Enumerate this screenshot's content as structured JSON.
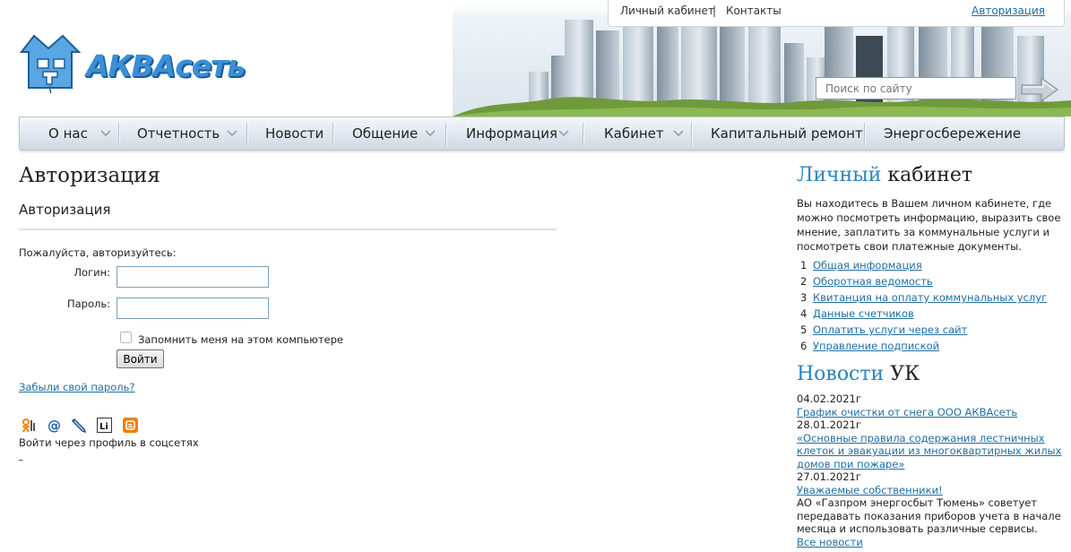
{
  "header": {
    "top_links": [
      "Личный кабинет",
      "Контакты"
    ],
    "top_separator": "|",
    "auth_link": "Авторизация",
    "logo_text": "АКВАсеть",
    "search_placeholder": "Поиск по сайту"
  },
  "nav": {
    "items": [
      {
        "label": "О нас",
        "has_dropdown": true
      },
      {
        "label": "Отчетность",
        "has_dropdown": true
      },
      {
        "label": "Новости",
        "has_dropdown": false
      },
      {
        "label": "Общение",
        "has_dropdown": true
      },
      {
        "label": "Информация",
        "has_dropdown": true
      },
      {
        "label": "Кабинет",
        "has_dropdown": true
      },
      {
        "label": "Капитальный ремонт",
        "has_dropdown": false
      },
      {
        "label": "Энергосбережение",
        "has_dropdown": false
      }
    ]
  },
  "main": {
    "title": "Авторизация",
    "subtitle": "Авторизация",
    "prompt": "Пожалуйста, авторизуйтесь:",
    "login_label": "Логин:",
    "login_value": "",
    "password_label": "Пароль:",
    "password_value": "",
    "remember_label": "Запомнить меня на этом компьютере",
    "remember_checked": false,
    "submit_label": "Войти",
    "forgot_link": "Забыли свой пароль?",
    "social_icons": [
      "odnoklassniki-icon",
      "mail-ru-icon",
      "livejournal-icon",
      "liveinternet-icon",
      "blogger-icon"
    ],
    "social_text": "Войти через профиль в соцсетях",
    "tiny_link": "_"
  },
  "sidebar": {
    "cabinet_title_accent": "Личный",
    "cabinet_title_rest": " кабинет",
    "cabinet_desc": "Вы находитесь в Вашем личном кабинете, где можно посмотреть информацию, выразить свое мнение, заплатить за коммунальные услуги и посмотреть свои платежные документы.",
    "cabinet_links": [
      {
        "num": "1",
        "label": "Общая информация"
      },
      {
        "num": "2",
        "label": "Оборотная ведомость"
      },
      {
        "num": "3",
        "label": "Квитанция на оплату коммунальных услуг"
      },
      {
        "num": "4",
        "label": "Данные счетчиков"
      },
      {
        "num": "5",
        "label": "Оплатить услуги через сайт"
      },
      {
        "num": "6",
        "label": "Управление подпиской"
      }
    ],
    "news_title_accent": "Новости",
    "news_title_rest": " УК",
    "news": [
      {
        "date": "04.02.2021г",
        "title": "График очистки от снега ООО АКВАсеть",
        "text": ""
      },
      {
        "date": "28.01.2021г",
        "title": "«Основные правила содержания лестничных клеток и эвакуации из многоквартирных жилых домов при пожаре»",
        "text": ""
      },
      {
        "date": "27.01.2021г",
        "title": "Уважаемые собственники!",
        "text": "АО «Газпром энергосбыт Тюмень» советует передавать показания приборов учета в начале месяца и использовать различные сервисы."
      }
    ],
    "all_news": "Все новости"
  },
  "colors": {
    "accent": "#2a83c2",
    "link": "#1f6ea5",
    "logo": "#3a8fd6"
  }
}
